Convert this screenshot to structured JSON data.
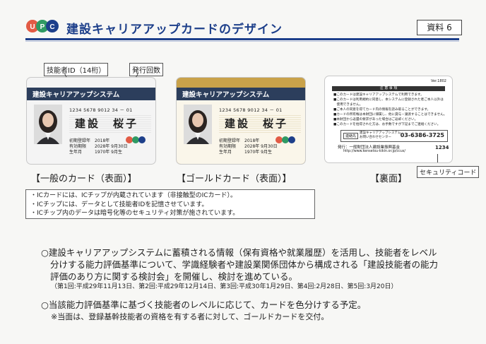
{
  "header": {
    "title": "建設キャリアアップカードのデザイン",
    "doc_label": "資料 6",
    "logo_text": "C"
  },
  "callouts": {
    "tech_id": "技能者ID（14桁）",
    "issue_count": "発行回数",
    "security_code": "セキュリティコード"
  },
  "card": {
    "band_text": "建設キャリアアップシステム",
    "number": "1234 5678 9012 34 － 01",
    "name": "建設　桜子",
    "rows": [
      {
        "k": "初期登録年",
        "v": "2018年"
      },
      {
        "k": "有効期限",
        "v": "2028年 9月30日"
      },
      {
        "k": "生年月",
        "v": "1970年 9月生"
      }
    ]
  },
  "back": {
    "header": "注 意 事 項",
    "lines": [
      "■このカードは建設キャリアアップシステムで利用できます。",
      "■このカードは利用規約に同意し、本システムに登録された者ご本人以外は",
      "　使用できません。",
      "■ご本人の同意を得てカード内の情報を読み取ることができます。",
      "■カードの所有権は本財団に帰属し、他に貸与・譲渡することはできません。",
      "■本財団から返還の要求があった場合はご返却ください。",
      "■このカードを拾得された方は、お手数ですが下記までご連絡ください。"
    ],
    "contact_label": "連絡先",
    "contact_org": "建設キャリアアップシステム\nお問い合わせセンター",
    "phone": "03-6386-3725",
    "issuer": "発行：一般財団法人建設業振興基金",
    "url": "http://www.kensetsu-kikin.or.jp/ccus/",
    "code": "1234",
    "serial": "Ver.1802"
  },
  "captions": {
    "general": "【一般のカード（表面）】",
    "gold": "【ゴールドカード（表面）】",
    "back": "【裏面】"
  },
  "notes": [
    "・ICカードには、ICチップが内蔵されています（非接触型のICカード）。",
    "・ICチップには、データとして技能者IDを記憶させています。",
    "・ICチップ内のデータは暗号化等のセキュリティ対策が施されています。"
  ],
  "paragraph1": [
    "○建設キャリアアップシステムに蓄積される情報（保有資格や就業履歴）を活用し、技能者をレベル",
    "分けする能力評価基準について、学識経験者や建設業関係団体から構成される「建設技能者の能力",
    "評価のあり方に関する検討会」を開催し、検討を進めている。"
  ],
  "meetings": "（第1回:平成29年11月13日、第2回:平成29年12月14日、第3回:平成30年1月29日、第4回:2月28日、第5回:3月20日）",
  "paragraph2": "○当該能力評価基準に基づく技能者のレベルに応じて、カードを色分けする予定。",
  "paragraph2_note": "※当面は、登録基幹技能者の資格を有する者に対して、ゴールドカードを交付。",
  "colors": {
    "navy": "#2c3e5c",
    "gold": "#c9a24a",
    "general_card": "#f4f4f4",
    "gold_card_body": "#faf6ea"
  }
}
